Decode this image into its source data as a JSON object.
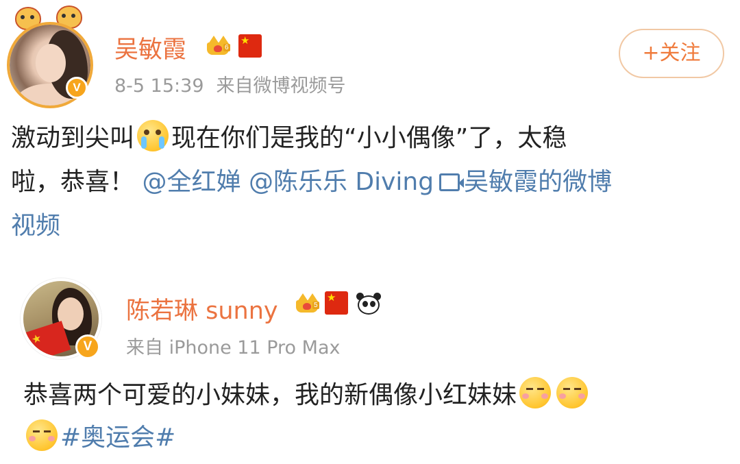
{
  "post1": {
    "author": "吴敏霞",
    "time": "8-5 15:39",
    "source": "来自微博视频号",
    "follow_label": "+关注",
    "text_a": "激动到尖叫",
    "text_b": "现在你们是我的“小小偶像”了，太稳",
    "text_c": "啦，恭喜！",
    "mention1": "@全红婵",
    "mention2": "@陈乐乐 Diving",
    "video_link": "吴敏霞的微博",
    "video_link2": "视频",
    "icons": [
      "crown-icon",
      "china-flag-icon",
      "cry-emoji",
      "video-link-icon",
      "verified-badge-icon"
    ]
  },
  "post2": {
    "author": "陈若琳 sunny",
    "source": "来自 iPhone 11 Pro Max",
    "text_a": "恭喜两个可爱的小妹妹，我的新偶像小红妹妹",
    "hashtag": "#奥运会#",
    "icons": [
      "crown-icon",
      "china-flag-icon",
      "panda-icon",
      "kiss-emoji",
      "verified-badge-icon"
    ]
  },
  "colors": {
    "name": "#eb7340",
    "link": "#507dad",
    "meta": "#9a9a9a",
    "follow_border": "#f1c8a4"
  }
}
